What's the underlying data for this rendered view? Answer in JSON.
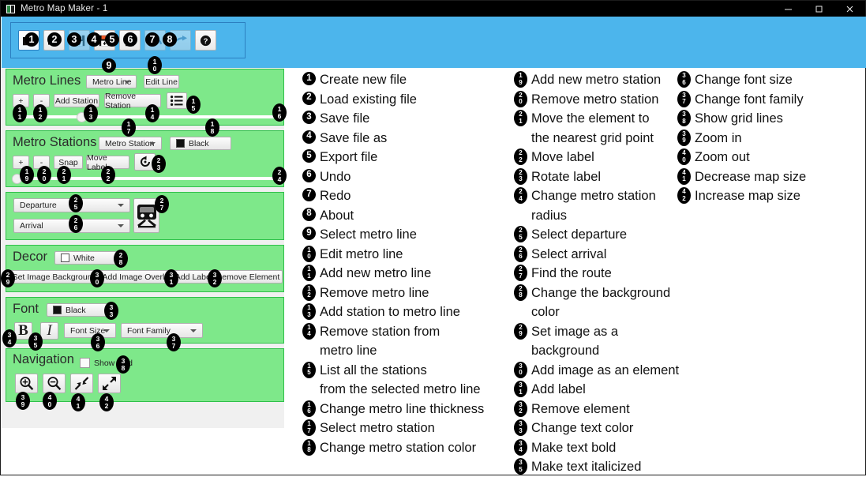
{
  "window": {
    "title": "Metro Map Maker - 1",
    "app_icon": "app-icon",
    "minimize": "minimize-icon",
    "maximize": "maximize-icon",
    "close": "close-icon"
  },
  "toolbar": {
    "buttons": [
      {
        "name": "new-file-button",
        "icon": "new-file-icon",
        "callout": "1",
        "state": "selected"
      },
      {
        "name": "open-file-button",
        "icon": "open-folder-icon",
        "callout": "2",
        "state": "normal"
      },
      {
        "name": "save-file-button",
        "icon": "save-disk-icon",
        "callout": "3",
        "state": "disabled"
      },
      {
        "name": "save-as-button",
        "icon": "save-as-icon",
        "callout": "4",
        "state": "normal"
      },
      {
        "name": "export-file-button",
        "icon": "export-file-icon",
        "callout": "5",
        "state": "normal"
      },
      {
        "name": "undo-button",
        "icon": "undo-arrow-icon",
        "callout": "6",
        "state": "disabled"
      },
      {
        "name": "redo-button",
        "icon": "redo-arrow-icon",
        "callout": "7",
        "state": "disabled"
      },
      {
        "name": "about-button",
        "icon": "question-mark-icon",
        "callout": "8",
        "state": "normal"
      }
    ]
  },
  "panels": {
    "metro_lines": {
      "heading": "Metro Lines",
      "line_combo": "Metro Line",
      "edit_line": "Edit Line",
      "add": "+",
      "remove": "-",
      "add_station": "Add Station",
      "remove_station": "Remove Station",
      "list_icon": "list-lines-icon",
      "callouts": {
        "combo": "9",
        "edit": "10",
        "add": "11",
        "remove": "12",
        "add_station": "13",
        "remove_station": "14",
        "list": "15",
        "thickness": "16"
      }
    },
    "metro_stations": {
      "heading": "Metro Stations",
      "station_combo": "Metro Station",
      "color_label": "Black",
      "add": "+",
      "remove": "-",
      "snap": "Snap",
      "move_label": "Move Label",
      "rotate_icon": "rotate-label-icon",
      "callouts": {
        "combo": "17",
        "color": "18",
        "add": "19",
        "remove": "20",
        "snap": "21",
        "move_label": "22",
        "rotate": "23",
        "radius": "24"
      }
    },
    "route": {
      "departure": "Departure",
      "arrival": "Arrival",
      "train_icon": "train-icon",
      "callouts": {
        "departure": "25",
        "arrival": "26",
        "route": "27"
      }
    },
    "decor": {
      "heading": "Decor",
      "color_label": "White",
      "set_image_background": "Set Image Background",
      "add_image_overlay": "Add Image Overlay",
      "add_label": "Add Label",
      "remove_element": "Remove Element",
      "callouts": {
        "color": "28",
        "set_bg": "29",
        "overlay": "30",
        "label": "31",
        "remove": "32"
      }
    },
    "font": {
      "heading": "Font",
      "color_label": "Black",
      "bold": "B",
      "italic": "I",
      "font_size": "Font Size",
      "font_family": "Font Family",
      "callouts": {
        "color": "33",
        "bold": "34",
        "italic": "35",
        "size": "36",
        "family": "37"
      }
    },
    "navigation": {
      "heading": "Navigation",
      "show_grid": "Show Grid",
      "zoom_in_icon": "zoom-in-icon",
      "zoom_out_icon": "zoom-out-icon",
      "shrink_icon": "decrease-map-size-icon",
      "expand_icon": "increase-map-size-icon",
      "callouts": {
        "grid": "38",
        "zoom_in": "39",
        "zoom_out": "40",
        "shrink": "41",
        "expand": "42"
      }
    }
  },
  "legend": {
    "col1": [
      {
        "n": "1",
        "text": "Create new file"
      },
      {
        "n": "2",
        "text": "Load existing file"
      },
      {
        "n": "3",
        "text": "Save file"
      },
      {
        "n": "4",
        "text": "Save file as"
      },
      {
        "n": "5",
        "text": "Export file"
      },
      {
        "n": "6",
        "text": "Undo"
      },
      {
        "n": "7",
        "text": "Redo"
      },
      {
        "n": "8",
        "text": "About"
      },
      {
        "n": "9",
        "text": "Select metro line"
      },
      {
        "n": "10",
        "text": "Edit metro line"
      },
      {
        "n": "11",
        "text": "Add new metro line"
      },
      {
        "n": "12",
        "text": "Remove metro line"
      },
      {
        "n": "13",
        "text": "Add station to metro line"
      },
      {
        "n": "14",
        "text": "Remove station from\nmetro line"
      },
      {
        "n": "15",
        "text": "List all the stations\nfrom the selected metro line"
      },
      {
        "n": "16",
        "text": "Change metro line thickness"
      },
      {
        "n": "17",
        "text": "Select metro station"
      },
      {
        "n": "18",
        "text": "Change metro station color"
      }
    ],
    "col2": [
      {
        "n": "19",
        "text": "Add new metro station"
      },
      {
        "n": "20",
        "text": "Remove metro station"
      },
      {
        "n": "21",
        "text": "Move the element to\nthe nearest grid point"
      },
      {
        "n": "22",
        "text": "Move label"
      },
      {
        "n": "23",
        "text": "Rotate label"
      },
      {
        "n": "24",
        "text": "Change metro station\nradius"
      },
      {
        "n": "25",
        "text": "Select departure"
      },
      {
        "n": "26",
        "text": "Select arrival"
      },
      {
        "n": "27",
        "text": "Find the route"
      },
      {
        "n": "28",
        "text": "Change the background\ncolor"
      },
      {
        "n": "29",
        "text": "Set image as a background"
      },
      {
        "n": "30",
        "text": "Add image as an element"
      },
      {
        "n": "31",
        "text": "Add label"
      },
      {
        "n": "32",
        "text": "Remove element"
      },
      {
        "n": "33",
        "text": "Change text color"
      },
      {
        "n": "34",
        "text": "Make text bold"
      },
      {
        "n": "35",
        "text": "Make text italicized"
      }
    ],
    "col3": [
      {
        "n": "36",
        "text": "Change font size"
      },
      {
        "n": "37",
        "text": "Change font family"
      },
      {
        "n": "38",
        "text": "Show grid lines"
      },
      {
        "n": "39",
        "text": "Zoom in"
      },
      {
        "n": "40",
        "text": "Zoom out"
      },
      {
        "n": "41",
        "text": "Decrease map size"
      },
      {
        "n": "42",
        "text": "Increase map size"
      }
    ]
  },
  "colors": {
    "titlebar": "#000000",
    "toolbar": "#4cb5ec",
    "panel": "#7ee88a",
    "panel_border": "#2fc04a",
    "callout": "#000000"
  }
}
